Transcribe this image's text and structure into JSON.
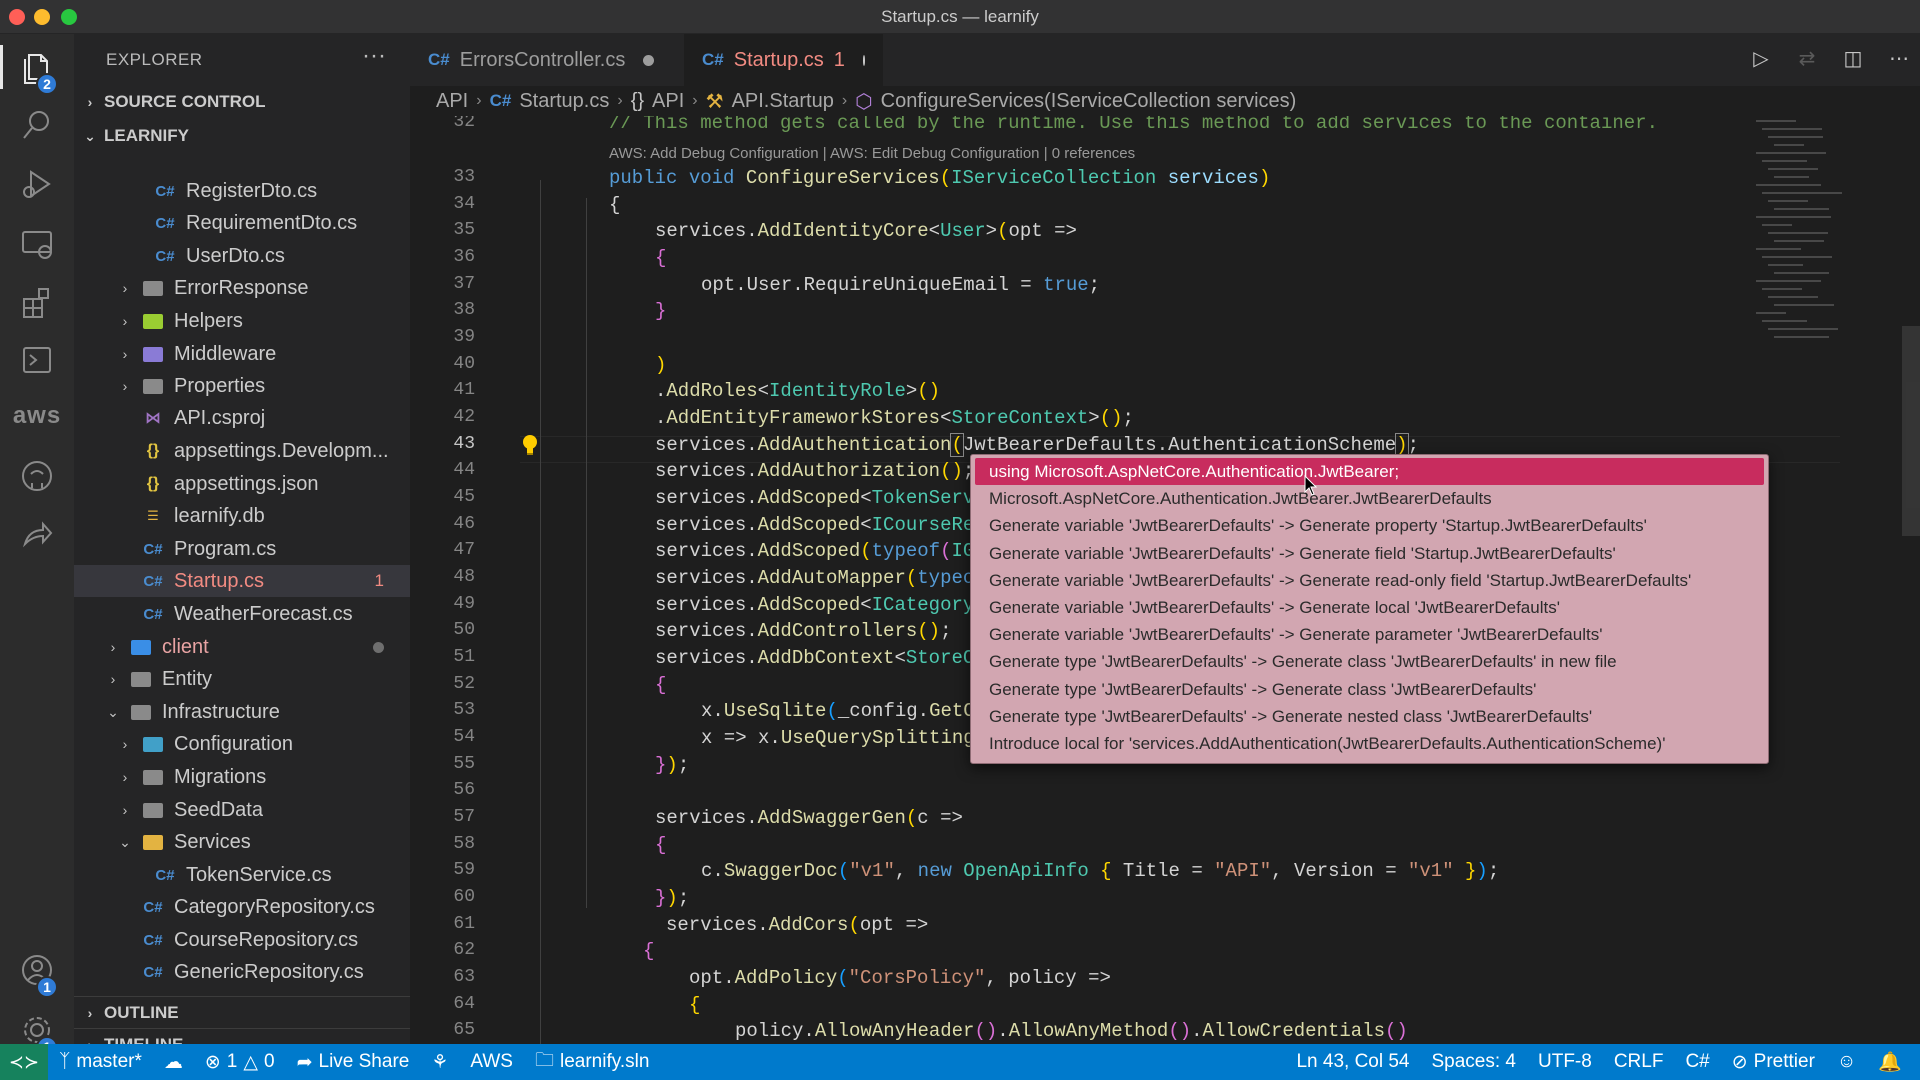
{
  "window": {
    "title": "Startup.cs — learnify"
  },
  "activity_bar": {
    "explorer_badge": "2",
    "accounts_badge": "1",
    "settings_badge": "1",
    "aws_label": "aws"
  },
  "sidebar": {
    "header": "EXPLORER",
    "more": "···",
    "source_control": "SOURCE CONTROL",
    "project": "LEARNIFY",
    "outline": "OUTLINE",
    "timeline": "TIMELINE",
    "items": [
      {
        "label": "RegisterDto.cs"
      },
      {
        "label": "RequirementDto.cs"
      },
      {
        "label": "UserDto.cs"
      },
      {
        "label": "ErrorResponse"
      },
      {
        "label": "Helpers"
      },
      {
        "label": "Middleware"
      },
      {
        "label": "Properties"
      },
      {
        "label": "API.csproj"
      },
      {
        "label": "appsettings.Developm..."
      },
      {
        "label": "appsettings.json"
      },
      {
        "label": "learnify.db"
      },
      {
        "label": "Program.cs"
      },
      {
        "label": "Startup.cs",
        "badge": "1"
      },
      {
        "label": "WeatherForecast.cs"
      },
      {
        "label": "client"
      },
      {
        "label": "Entity"
      },
      {
        "label": "Infrastructure"
      },
      {
        "label": "Configuration"
      },
      {
        "label": "Migrations"
      },
      {
        "label": "SeedData"
      },
      {
        "label": "Services"
      },
      {
        "label": "TokenService.cs"
      },
      {
        "label": "CategoryRepository.cs"
      },
      {
        "label": "CourseRepository.cs"
      },
      {
        "label": "GenericRepository.cs"
      }
    ]
  },
  "tabs": [
    {
      "icon": "C#",
      "label": "ErrorsController.cs",
      "count": ""
    },
    {
      "icon": "C#",
      "label": "Startup.cs",
      "count": "1"
    }
  ],
  "breadcrumb": {
    "items": [
      "API",
      "Startup.cs",
      "API",
      "API.Startup",
      "ConfigureServices(IServiceCollection services)"
    ],
    "csharp_icon": "C#",
    "namespace_icon": "{}"
  },
  "editor": {
    "codelens": "AWS: Add Debug Configuration | AWS: Edit Debug Configuration | 0 references",
    "current_line": 43,
    "line_numbers": [
      "32",
      "33",
      "34",
      "35",
      "36",
      "37",
      "38",
      "39",
      "40",
      "41",
      "42",
      "43",
      "44",
      "45",
      "46",
      "47",
      "48",
      "49",
      "50",
      "51",
      "52",
      "53",
      "54",
      "55",
      "56",
      "57",
      "58",
      "59",
      "60",
      "61",
      "62",
      "63",
      "64",
      "65"
    ]
  },
  "quick_fix": {
    "items": [
      "using Microsoft.AspNetCore.Authentication.JwtBearer;",
      "Microsoft.AspNetCore.Authentication.JwtBearer.JwtBearerDefaults",
      "Generate variable 'JwtBearerDefaults' -> Generate property 'Startup.JwtBearerDefaults'",
      "Generate variable 'JwtBearerDefaults' -> Generate field 'Startup.JwtBearerDefaults'",
      "Generate variable 'JwtBearerDefaults' -> Generate read-only field 'Startup.JwtBearerDefaults'",
      "Generate variable 'JwtBearerDefaults' -> Generate local 'JwtBearerDefaults'",
      "Generate variable 'JwtBearerDefaults' -> Generate parameter 'JwtBearerDefaults'",
      "Generate type 'JwtBearerDefaults' -> Generate class 'JwtBearerDefaults' in new file",
      "Generate type 'JwtBearerDefaults' -> Generate class 'JwtBearerDefaults'",
      "Generate type 'JwtBearerDefaults' -> Generate nested class 'JwtBearerDefaults'",
      "Introduce local for 'services.AddAuthentication(JwtBearerDefaults.AuthenticationScheme)'"
    ]
  },
  "status_bar": {
    "branch": "master*",
    "errors": "1",
    "warnings": "0",
    "live_share": "Live Share",
    "aws": "AWS",
    "solution": "learnify.sln",
    "cursor": "Ln 43, Col 54",
    "spaces": "Spaces: 4",
    "encoding": "UTF-8",
    "eol": "CRLF",
    "language": "C#",
    "prettier": "Prettier"
  }
}
